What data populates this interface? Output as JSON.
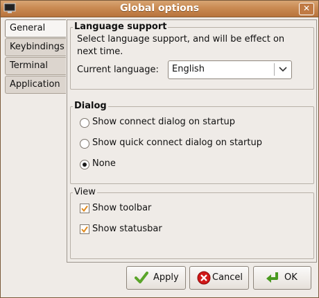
{
  "window": {
    "title": "Global options"
  },
  "tabs": [
    {
      "label": "General",
      "active": true
    },
    {
      "label": "Keybindings",
      "active": false
    },
    {
      "label": "Terminal",
      "active": false
    },
    {
      "label": "Application",
      "active": false
    }
  ],
  "language_support": {
    "heading": "Language support",
    "description_line1": "Select language support, and will be effect on",
    "description_line2": "next time.",
    "current_language_label": "Current language:",
    "current_language_value": "English"
  },
  "dialog": {
    "heading": "Dialog",
    "options": [
      {
        "label": "Show connect dialog on startup",
        "selected": false
      },
      {
        "label": "Show quick connect dialog on startup",
        "selected": false
      },
      {
        "label": "None",
        "selected": true
      }
    ]
  },
  "view": {
    "heading": "View",
    "options": [
      {
        "label": "Show toolbar",
        "checked": true
      },
      {
        "label": "Show statusbar",
        "checked": true
      }
    ]
  },
  "buttons": {
    "apply": "Apply",
    "cancel": "Cancel",
    "ok": "OK"
  },
  "colors": {
    "titlebar": "#c98a52",
    "check_accent": "#e08a1e",
    "cancel_red": "#d01818",
    "ok_green": "#4a9a20"
  }
}
